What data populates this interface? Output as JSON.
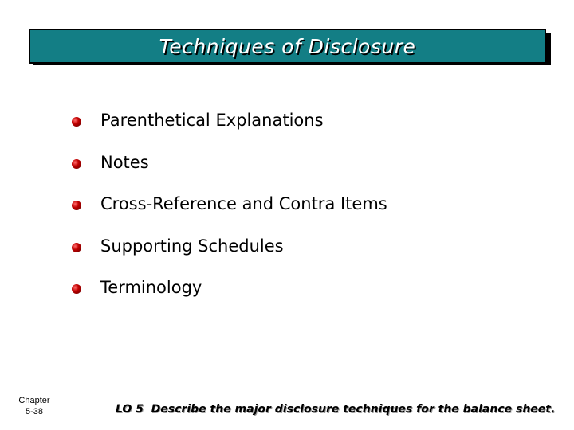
{
  "slide": {
    "title": "Techniques of Disclosure",
    "colors": {
      "title_background": "#137e85",
      "title_text": "#ffffff",
      "bullet": "#c00000"
    },
    "bullets": [
      {
        "label": "Parenthetical Explanations",
        "icon": "red-sphere-bullet"
      },
      {
        "label": "Notes",
        "icon": "red-sphere-bullet"
      },
      {
        "label": "Cross-Reference and Contra Items",
        "icon": "red-sphere-bullet"
      },
      {
        "label": "Supporting Schedules",
        "icon": "red-sphere-bullet"
      },
      {
        "label": "Terminology",
        "icon": "red-sphere-bullet"
      }
    ],
    "footer": {
      "chapter_label": "Chapter",
      "page": "5-38",
      "learning_objective": "LO 5  Describe the major disclosure techniques for the balance sheet."
    }
  }
}
